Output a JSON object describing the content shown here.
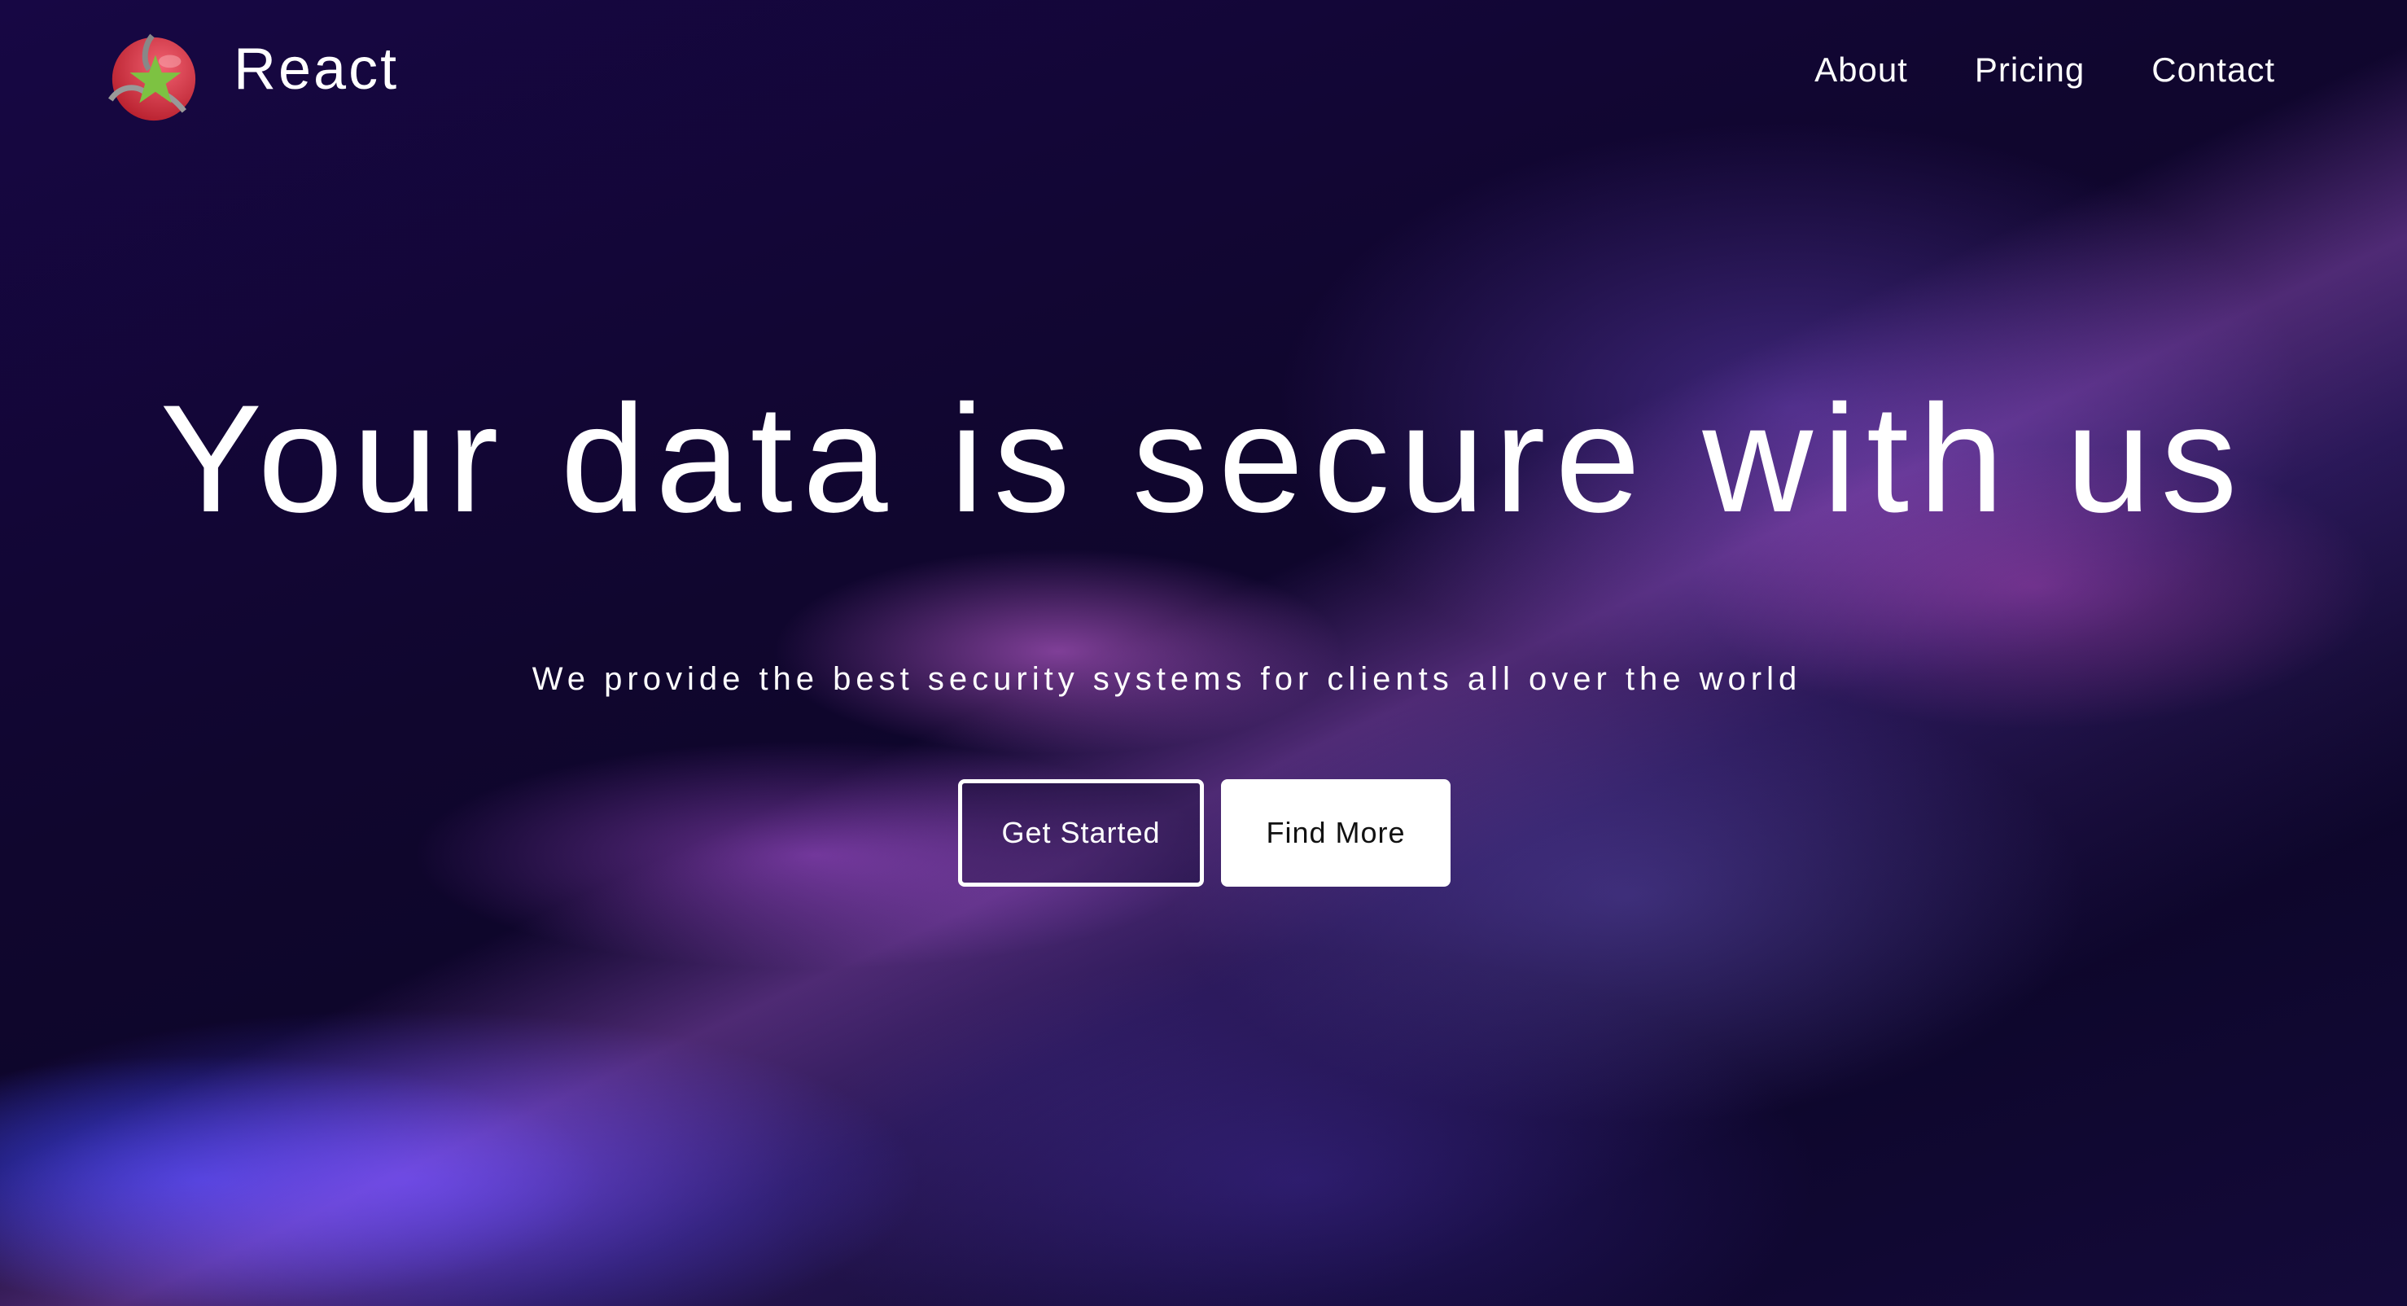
{
  "brand": {
    "name": "React",
    "logo_icon": "red-sphere-green-star-logo"
  },
  "nav": {
    "items": [
      {
        "label": "About"
      },
      {
        "label": "Pricing"
      },
      {
        "label": "Contact"
      }
    ]
  },
  "hero": {
    "title": "Your data is secure with us",
    "subtitle": "We provide the best security systems for clients all over the world",
    "primary_button": "Get Started",
    "secondary_button": "Find More"
  }
}
